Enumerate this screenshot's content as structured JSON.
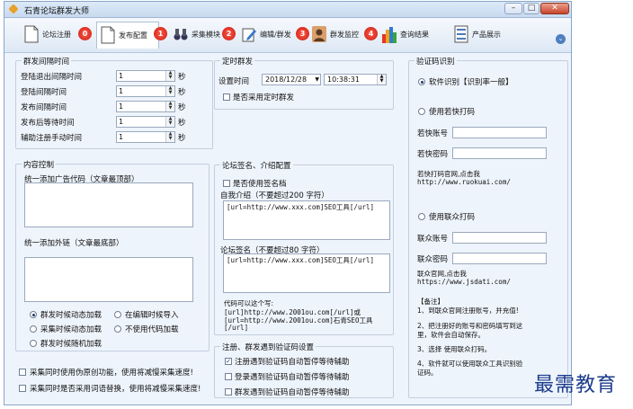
{
  "window": {
    "title": "石青论坛群发大师",
    "minimize": "–",
    "maximize": "□",
    "close": "✕"
  },
  "toolbar": {
    "items": [
      {
        "label": "论坛注册",
        "icon": "document-icon"
      },
      {
        "label": "发布配置",
        "icon": "document-icon"
      },
      {
        "label": "采集模块",
        "icon": "binoculars-icon"
      },
      {
        "label": "编辑/群发",
        "icon": "edit-icon"
      },
      {
        "label": "群发监控",
        "icon": "user-icon"
      },
      {
        "label": "查询结果",
        "icon": "bar-chart-icon"
      },
      {
        "label": "产品展示",
        "icon": "list-icon"
      }
    ],
    "badges": [
      "0",
      "1",
      "2",
      "3",
      "4"
    ],
    "collapse": "⌄"
  },
  "login_interval": {
    "title": "群发间隔时间",
    "rows": [
      {
        "label": "登陆退出间隔时间",
        "value": "1",
        "unit": "秒"
      },
      {
        "label": "登陆间隔时间",
        "value": "1",
        "unit": "秒"
      },
      {
        "label": "发布间隔时间",
        "value": "1",
        "unit": "秒"
      },
      {
        "label": "发布后等待时间",
        "value": "1",
        "unit": "秒"
      },
      {
        "label": "辅助注册手动时间",
        "value": "1",
        "unit": "秒"
      }
    ]
  },
  "timer": {
    "title": "定时群发",
    "set_label": "设置时间",
    "date": "2018/12/28",
    "time": "10:38:31",
    "use_timer": "是否采用定时群发"
  },
  "captcha": {
    "title": "验证码识别",
    "soft": "软件识别【识别率一般】",
    "ruokuai": "使用若快打码",
    "ruokuai_account": "若快账号",
    "ruokuai_password": "若快密码",
    "ruokuai_site": "若快打码官网,点击我",
    "ruokuai_url": "http://www.ruokuai.com/",
    "lianzhong": "使用联众打码",
    "lianzhong_account": "联众账号",
    "lianzhong_password": "联众密码",
    "lianzhong_site": "联众官网,点击我",
    "lianzhong_url": "https://www.jsdati.com/",
    "notes_title": "【备注】",
    "notes": [
      "1、到联众官网注册账号，并充值!",
      "2、把注册好的账号和密码填写到这",
      "里，软件会自动保存。",
      "3、选择 使用联众打码。",
      "4、软件就可以使用联众工具识别验",
      "证码。"
    ]
  },
  "content": {
    "title": "内容控制",
    "top_label": "统一添加广告代码（文章最顶部）",
    "bottom_label": "统一添加外链（文章最底部）",
    "options": [
      {
        "label": "群发时候动态加载",
        "on": true
      },
      {
        "label": "在编辑时候导入",
        "on": false
      },
      {
        "label": "采集时候动态加载",
        "on": false
      },
      {
        "label": "不使用代码加载",
        "on": false
      },
      {
        "label": "群发时候随机加载",
        "on": false
      }
    ]
  },
  "signature": {
    "title": "论坛签名、介绍配置",
    "use_sig": "是否使用签名档",
    "intro_label": "自我介绍（不要超过200 字符）",
    "intro_value": "[url=http://www.xxx.com]SEO工具[/url]",
    "sig_label": "论坛签名（不要超过80 字符）",
    "sig_value": "[url=http://www.xxx.com]SEO工具[/url]",
    "code_hint": [
      "代码可以这个写:",
      "[url]http://www.2001ou.com[/url]或",
      "[url=http://www.2001ou.com]石青SEO工具",
      "[/url]"
    ]
  },
  "captcha_wait": {
    "title": "注册、群发遇到验证码设置",
    "options": [
      {
        "label": "注册遇到验证码自动暂停等待辅助",
        "on": true
      },
      {
        "label": "登录遇到验证码自动暂停等待辅助",
        "on": false
      },
      {
        "label": "群发遇到验证码自动暂停等待辅助",
        "on": false
      }
    ]
  },
  "footer_options": [
    "采集同时使用伪原创功能，使用将减慢采集速度!",
    "采集同时是否采用词语替换，使用将减慢采集速度!"
  ],
  "watermark": "最需教育"
}
